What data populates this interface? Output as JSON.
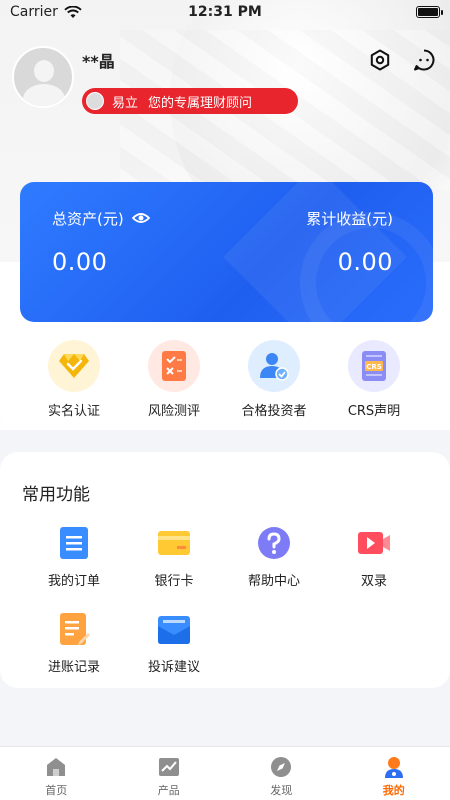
{
  "status_bar": {
    "carrier": "Carrier",
    "time": "12:31 PM"
  },
  "profile": {
    "user_name": "**晶",
    "advisor_name": "易立",
    "advisor_text": "您的专属理财顾问"
  },
  "top_icons": [
    "settings-icon",
    "message-icon"
  ],
  "assets": {
    "total_label": "总资产(元)",
    "total_value": "0.00",
    "income_label": "累计收益(元)",
    "income_value": "0.00"
  },
  "quick_actions": [
    {
      "label": "实名认证",
      "icon": "verified-diamond-icon"
    },
    {
      "label": "风险测评",
      "icon": "risk-assessment-icon"
    },
    {
      "label": "合格投资者",
      "icon": "qualified-investor-icon"
    },
    {
      "label": "CRS声明",
      "icon": "crs-statement-icon"
    }
  ],
  "functions": {
    "title": "常用功能",
    "items": [
      {
        "label": "我的订单",
        "icon": "order-list-icon"
      },
      {
        "label": "银行卡",
        "icon": "bank-card-icon"
      },
      {
        "label": "帮助中心",
        "icon": "help-icon"
      },
      {
        "label": "双录",
        "icon": "video-record-icon"
      },
      {
        "label": "进账记录",
        "icon": "income-record-icon"
      },
      {
        "label": "投诉建议",
        "icon": "complaint-mail-icon"
      }
    ]
  },
  "tabs": [
    {
      "label": "首页",
      "icon": "home-icon",
      "active": false
    },
    {
      "label": "产品",
      "icon": "product-chart-icon",
      "active": false
    },
    {
      "label": "发现",
      "icon": "compass-icon",
      "active": false
    },
    {
      "label": "我的",
      "icon": "profile-icon",
      "active": true
    }
  ],
  "colors": {
    "advisor_pill": "#e8242c",
    "card_blue": "#2f7bff",
    "tab_active": "#ff6a00"
  }
}
